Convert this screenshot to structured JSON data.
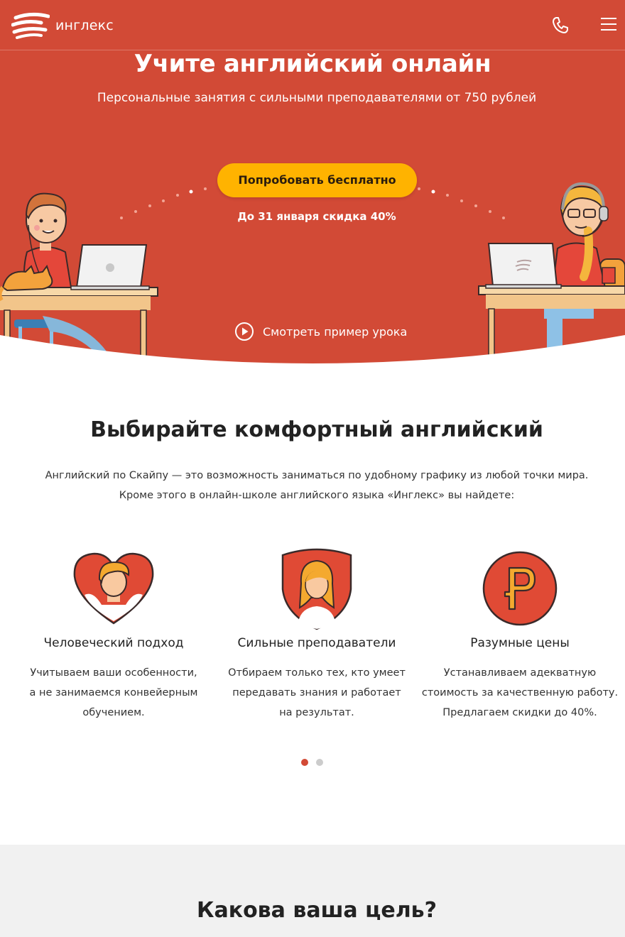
{
  "header": {
    "logo_text": "инглекс",
    "phone_icon": "phone-icon",
    "menu_icon": "hamburger-menu-icon"
  },
  "hero": {
    "title": "Учите английский онлайн",
    "subtitle": "Персональные занятия с сильными преподавателями от 750 рублей",
    "cta_label": "Попробовать бесплатно",
    "promo_text": "До 31 января скидка 40%",
    "watch_label": "Смотреть пример урока"
  },
  "section_comfort": {
    "title": "Выбирайте комфортный английский",
    "line1": "Английский по Скайпу — это возможность заниматься по удобному графику из любой точки мира.",
    "line2": "Кроме этого в онлайн-школе английского языка «Инглекс» вы найдете:",
    "features": [
      {
        "icon": "heart-person-icon",
        "title": "Человеческий подход",
        "lines": [
          "Учитываем ваши особенности,",
          "а не занимаемся конвейерным",
          "обучением."
        ]
      },
      {
        "icon": "shield-teacher-icon",
        "title": "Сильные преподаватели",
        "lines": [
          "Отбираем только тех, кто умеет",
          "передавать знания и работает",
          "на результат."
        ]
      },
      {
        "icon": "ruble-icon",
        "title": "Разумные цены",
        "lines": [
          "Устанавливаем адекватную",
          "стоимость за качественную работу.",
          "Предлагаем скидки до 40%."
        ]
      }
    ]
  },
  "carousel": {
    "active_index": 0,
    "count": 2
  },
  "section_goal": {
    "title": "Какова ваша цель?"
  },
  "colors": {
    "brand_red": "#d24a36",
    "cta_yellow": "#ffb300",
    "dot_active": "#d24a36",
    "dot_inactive": "#cccccc",
    "goal_bg": "#f1f1f1"
  }
}
